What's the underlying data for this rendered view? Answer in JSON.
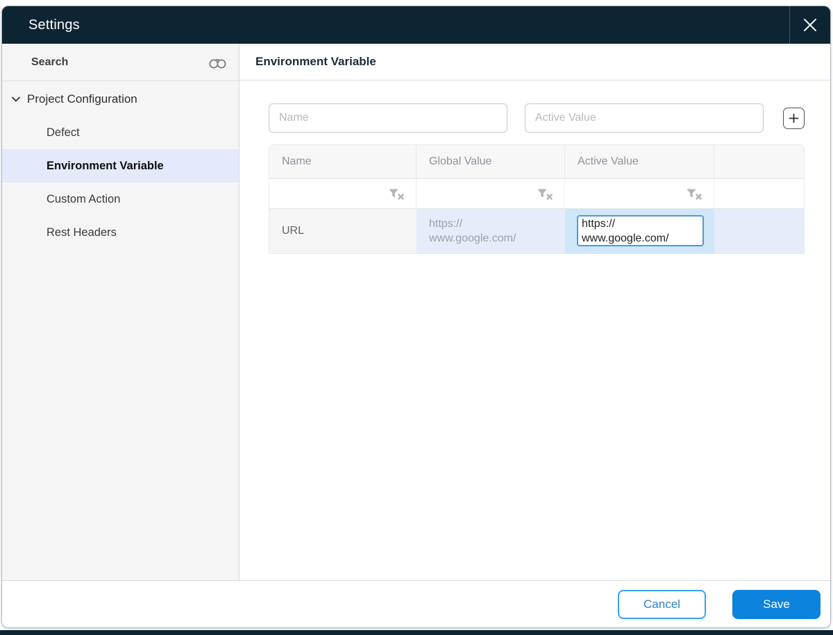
{
  "dialog": {
    "title": "Settings"
  },
  "sidebar": {
    "search_label": "Search",
    "tree": {
      "parent_label": "Project Configuration",
      "items": [
        {
          "label": "Defect",
          "selected": false
        },
        {
          "label": "Environment Variable",
          "selected": true
        },
        {
          "label": "Custom Action",
          "selected": false
        },
        {
          "label": "Rest Headers",
          "selected": false
        }
      ]
    }
  },
  "main": {
    "title": "Environment Variable",
    "name_placeholder": "Name",
    "active_value_placeholder": "Active Value",
    "table": {
      "columns": [
        "Name",
        "Global Value",
        "Active Value",
        ""
      ],
      "rows": [
        {
          "name": "URL",
          "global_value": "https://\nwww.google.com/",
          "active_value": "https://\nwww.google.com/"
        }
      ]
    }
  },
  "footer": {
    "cancel_label": "Cancel",
    "save_label": "Save"
  },
  "icons": {
    "close": "close-icon",
    "search": "binoculars-search-icon",
    "expand": "chevron-down-icon",
    "add": "plus-icon",
    "filter": "filter-clear-icon"
  },
  "colors": {
    "header_bg": "#0d2433",
    "accent_blue": "#0c83dc",
    "cancel_border_blue": "#35a1f3",
    "selected_item_bg": "#e4eafb",
    "global_cell_bg": "#e7ecfa",
    "active_cell_bg": "#cfe7f8",
    "active_input_border": "#4f97dd",
    "sidebar_bg": "#f5f5f5",
    "table_header_bg": "#f7f7f7"
  }
}
